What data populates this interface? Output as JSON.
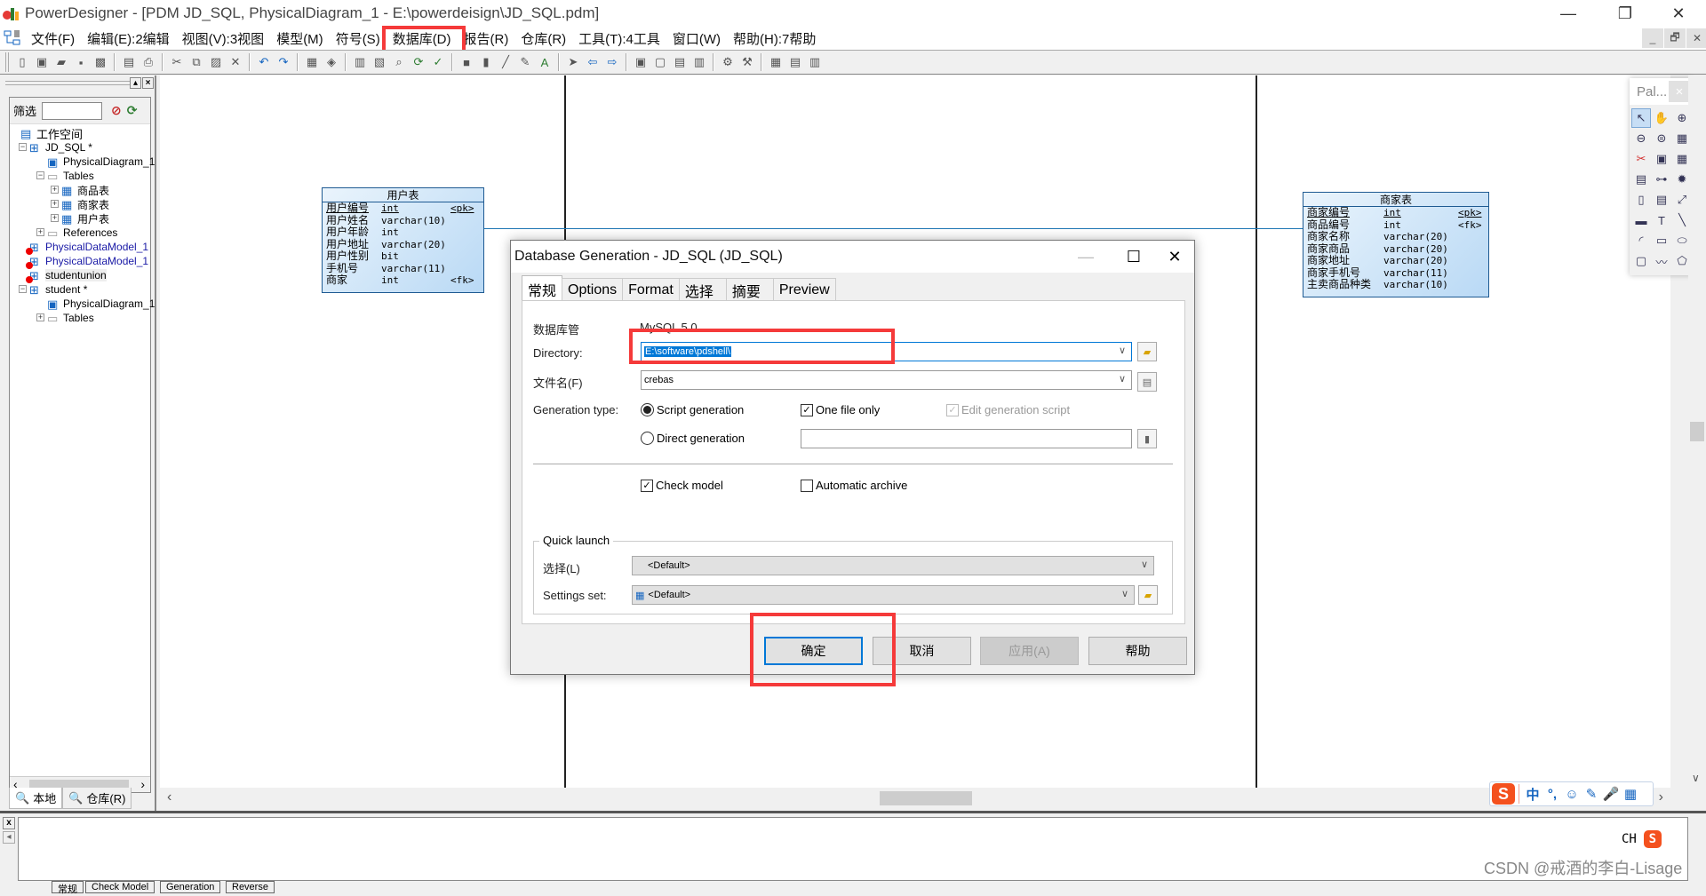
{
  "window": {
    "title": "PowerDesigner - [PDM JD_SQL, PhysicalDiagram_1 - E:\\powerdeisign\\JD_SQL.pdm]",
    "minimize": "—",
    "restore": "❐",
    "close": "✕"
  },
  "menubar": {
    "items": [
      "文件(F)",
      "编辑(E):2编辑",
      "视图(V):3视图",
      "模型(M)",
      "符号(S)",
      "数据库(D)",
      "报告(R)",
      "仓库(R)",
      "工具(T):4工具",
      "窗口(W)",
      "帮助(H):7帮助"
    ],
    "highlighted": "数据库(D)",
    "mdi_minimize": "_",
    "mdi_restore": "🗗",
    "mdi_close": "✕"
  },
  "toolbar": {
    "icons": [
      "new-icon",
      "new-project-icon",
      "open-icon",
      "save-icon",
      "save-all-icon",
      "print-preview-icon",
      "print-icon",
      "cut-icon",
      "copy-icon",
      "paste-icon",
      "delete-icon",
      "undo-icon",
      "redo-icon",
      "properties-icon",
      "help-icon",
      "new-model-icon",
      "repository-icon",
      "find-icon",
      "update-icon",
      "check-model-icon",
      "fill-icon",
      "shadow-icon",
      "pen-icon",
      "brush-icon",
      "font-icon",
      "arrow-icon",
      "back-icon",
      "forward-icon",
      "diagram1-icon",
      "diagram2-icon",
      "diagram3-icon",
      "diagram4-icon",
      "generate-icon",
      "reverse-icon",
      "browser-toggle-icon",
      "output-toggle-icon",
      "result-toggle-icon"
    ]
  },
  "browser": {
    "filter_label": "筛选",
    "filter_value": "",
    "tree": [
      {
        "label": "工作空间",
        "level": 0,
        "type": "workspace"
      },
      {
        "label": "JD_SQL *",
        "level": 1,
        "type": "model",
        "expanded": true
      },
      {
        "label": "PhysicalDiagram_1",
        "level": 2,
        "type": "diagram"
      },
      {
        "label": "Tables",
        "level": 2,
        "type": "folder",
        "expanded": true
      },
      {
        "label": "商品表",
        "level": 3,
        "type": "table"
      },
      {
        "label": "商家表",
        "level": 3,
        "type": "table"
      },
      {
        "label": "用户表",
        "level": 3,
        "type": "table"
      },
      {
        "label": "References",
        "level": 2,
        "type": "folder"
      },
      {
        "label": "PhysicalDataModel_1",
        "level": 1,
        "type": "closed-model",
        "color": "#1a1aa6"
      },
      {
        "label": "PhysicalDataModel_1",
        "level": 1,
        "type": "closed-model",
        "color": "#1a1aa6"
      },
      {
        "label": "studentunion",
        "level": 1,
        "type": "closed-model"
      },
      {
        "label": "student *",
        "level": 1,
        "type": "model",
        "expanded": true
      },
      {
        "label": "PhysicalDiagram_1",
        "level": 2,
        "type": "diagram"
      },
      {
        "label": "Tables",
        "level": 2,
        "type": "folder"
      }
    ],
    "tabs": [
      "本地",
      "仓库(R)"
    ]
  },
  "canvas": {
    "entities": [
      {
        "name": "用户表",
        "columns": [
          {
            "name": "用户编号",
            "type": "int",
            "key": "<pk>",
            "underline": true
          },
          {
            "name": "用户姓名",
            "type": "varchar(10)",
            "key": ""
          },
          {
            "name": "用户年龄",
            "type": "int",
            "key": ""
          },
          {
            "name": "用户地址",
            "type": "varchar(20)",
            "key": ""
          },
          {
            "name": "用户性别",
            "type": "bit",
            "key": ""
          },
          {
            "name": "手机号",
            "type": "varchar(11)",
            "key": ""
          },
          {
            "name": "商家",
            "type": "int",
            "key": "<fk>"
          }
        ]
      },
      {
        "name": "商家表",
        "columns": [
          {
            "name": "商家编号",
            "type": "int",
            "key": "<pk>",
            "underline": true
          },
          {
            "name": "商品编号",
            "type": "int",
            "key": "<fk>"
          },
          {
            "name": "商家名称",
            "type": "varchar(20)",
            "key": ""
          },
          {
            "name": "商家商品",
            "type": "varchar(20)",
            "key": ""
          },
          {
            "name": "商家地址",
            "type": "varchar(20)",
            "key": ""
          },
          {
            "name": "商家手机号",
            "type": "varchar(11)",
            "key": ""
          },
          {
            "name": "主卖商品种类",
            "type": "varchar(10)",
            "key": ""
          }
        ]
      }
    ]
  },
  "palette": {
    "title": "Pal...",
    "close": "×",
    "tools": [
      "pointer-icon",
      "grabber-icon",
      "zoom-in-icon",
      "zoom-out-icon",
      "open-view-icon",
      "properties-icon",
      "cut-icon",
      "package-icon",
      "table-icon",
      "view-icon",
      "reference-icon",
      "procedure-icon",
      "file-icon",
      "note-icon",
      "link-icon",
      "title-icon",
      "text-icon",
      "line-icon",
      "arc-icon",
      "rectangle-icon",
      "ellipse-icon",
      "rounded-rectangle-icon",
      "polyline-icon",
      "polygon-icon"
    ]
  },
  "dialog": {
    "title": "Database Generation - JD_SQL (JD_SQL)",
    "tabs": [
      "常规",
      "Options",
      "Format",
      "选择",
      "摘要",
      "Preview"
    ],
    "active_tab": "常规",
    "dbms_label": "数据库管",
    "dbms_value": "MySQL 5.0",
    "directory_label": "Directory:",
    "directory_value": "E:\\software\\pdshell\\",
    "filename_label": "文件名(F)",
    "filename_value": "crebas",
    "generation_type_label": "Generation type:",
    "script_generation": "Script generation",
    "script_generation_selected": true,
    "direct_generation": "Direct generation",
    "direct_generation_selected": false,
    "one_file_only": "One file only",
    "one_file_only_checked": true,
    "edit_generation_script": "Edit generation script",
    "edit_generation_script_checked": true,
    "edit_generation_script_disabled": true,
    "data_source_value": "",
    "check_model": "Check model",
    "check_model_checked": true,
    "automatic_archive": "Automatic archive",
    "automatic_archive_checked": false,
    "quick_launch_label": "Quick launch",
    "selection_label": "选择(L)",
    "selection_value": "<Default>",
    "settings_set_label": "Settings set:",
    "settings_set_value": "<Default>",
    "buttons": {
      "ok": "确定",
      "cancel": "取消",
      "apply": "应用(A)",
      "help": "帮助"
    },
    "check": "✓",
    "chevron": "∨"
  },
  "output": {
    "tabs": [
      "常规",
      "Check Model",
      "Generation",
      "Reverse"
    ],
    "close": "x",
    "left": "◂"
  },
  "ime": {
    "logo": "S",
    "items": [
      "中",
      "°,",
      "☺",
      "✎",
      "🎤",
      "▦"
    ],
    "lang": "CH"
  },
  "watermark": "CSDN @戒酒的李白-Lisage",
  "colors": {
    "highlight_red": "#f53a3a",
    "entity_border": "#1e5a92",
    "accent_blue": "#0078d7",
    "reference_line": "#1f77b4"
  }
}
